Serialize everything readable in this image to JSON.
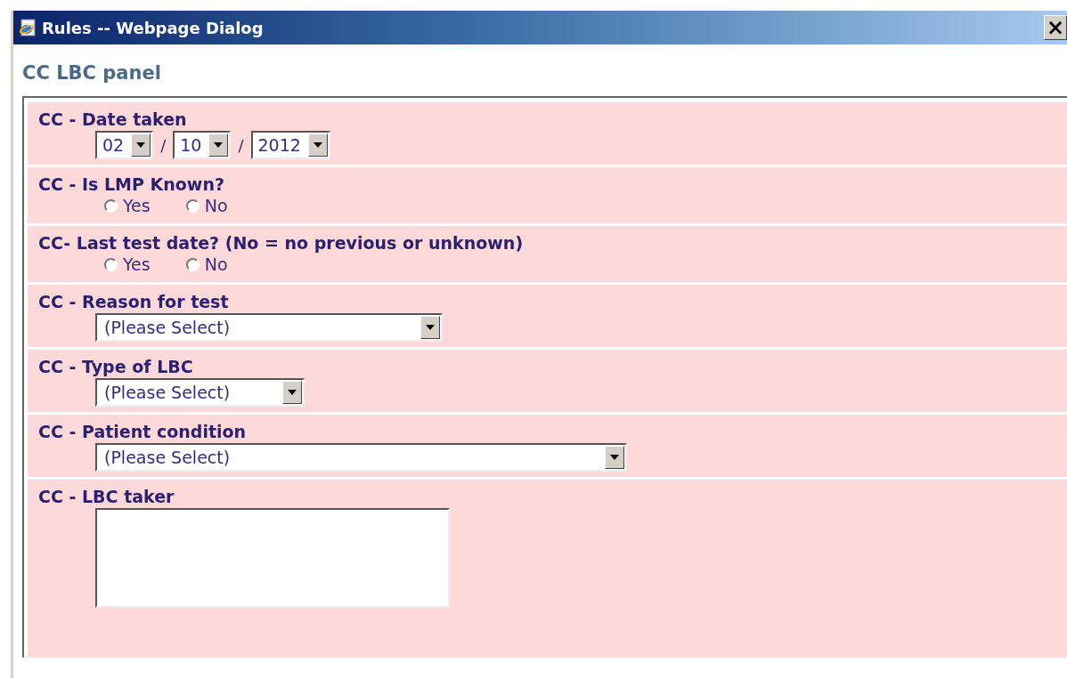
{
  "window": {
    "title": "Rules -- Webpage Dialog",
    "close": "×"
  },
  "panel": {
    "title": "CC LBC panel"
  },
  "fields": [
    {
      "kind": "date",
      "label": "CC - Date taken",
      "parts": [
        "02",
        "10",
        "2012"
      ],
      "separator": "/"
    },
    {
      "kind": "radio",
      "label": "CC - Is LMP Known?",
      "options": [
        {
          "label": "Yes",
          "selected": false
        },
        {
          "label": "No",
          "selected": false
        }
      ]
    },
    {
      "kind": "radio",
      "label": "CC- Last test date? (No = no previous or unknown)",
      "options": [
        {
          "label": "Yes",
          "selected": false
        },
        {
          "label": "No",
          "selected": false
        }
      ]
    },
    {
      "kind": "select",
      "label": "CC - Reason for test",
      "value": "(Please Select)"
    },
    {
      "kind": "select",
      "label": "CC - Type of LBC",
      "value": "(Please Select)"
    },
    {
      "kind": "select",
      "label": "CC - Patient condition",
      "value": "(Please Select)"
    },
    {
      "kind": "textarea",
      "label": "CC - LBC taker"
    }
  ]
}
